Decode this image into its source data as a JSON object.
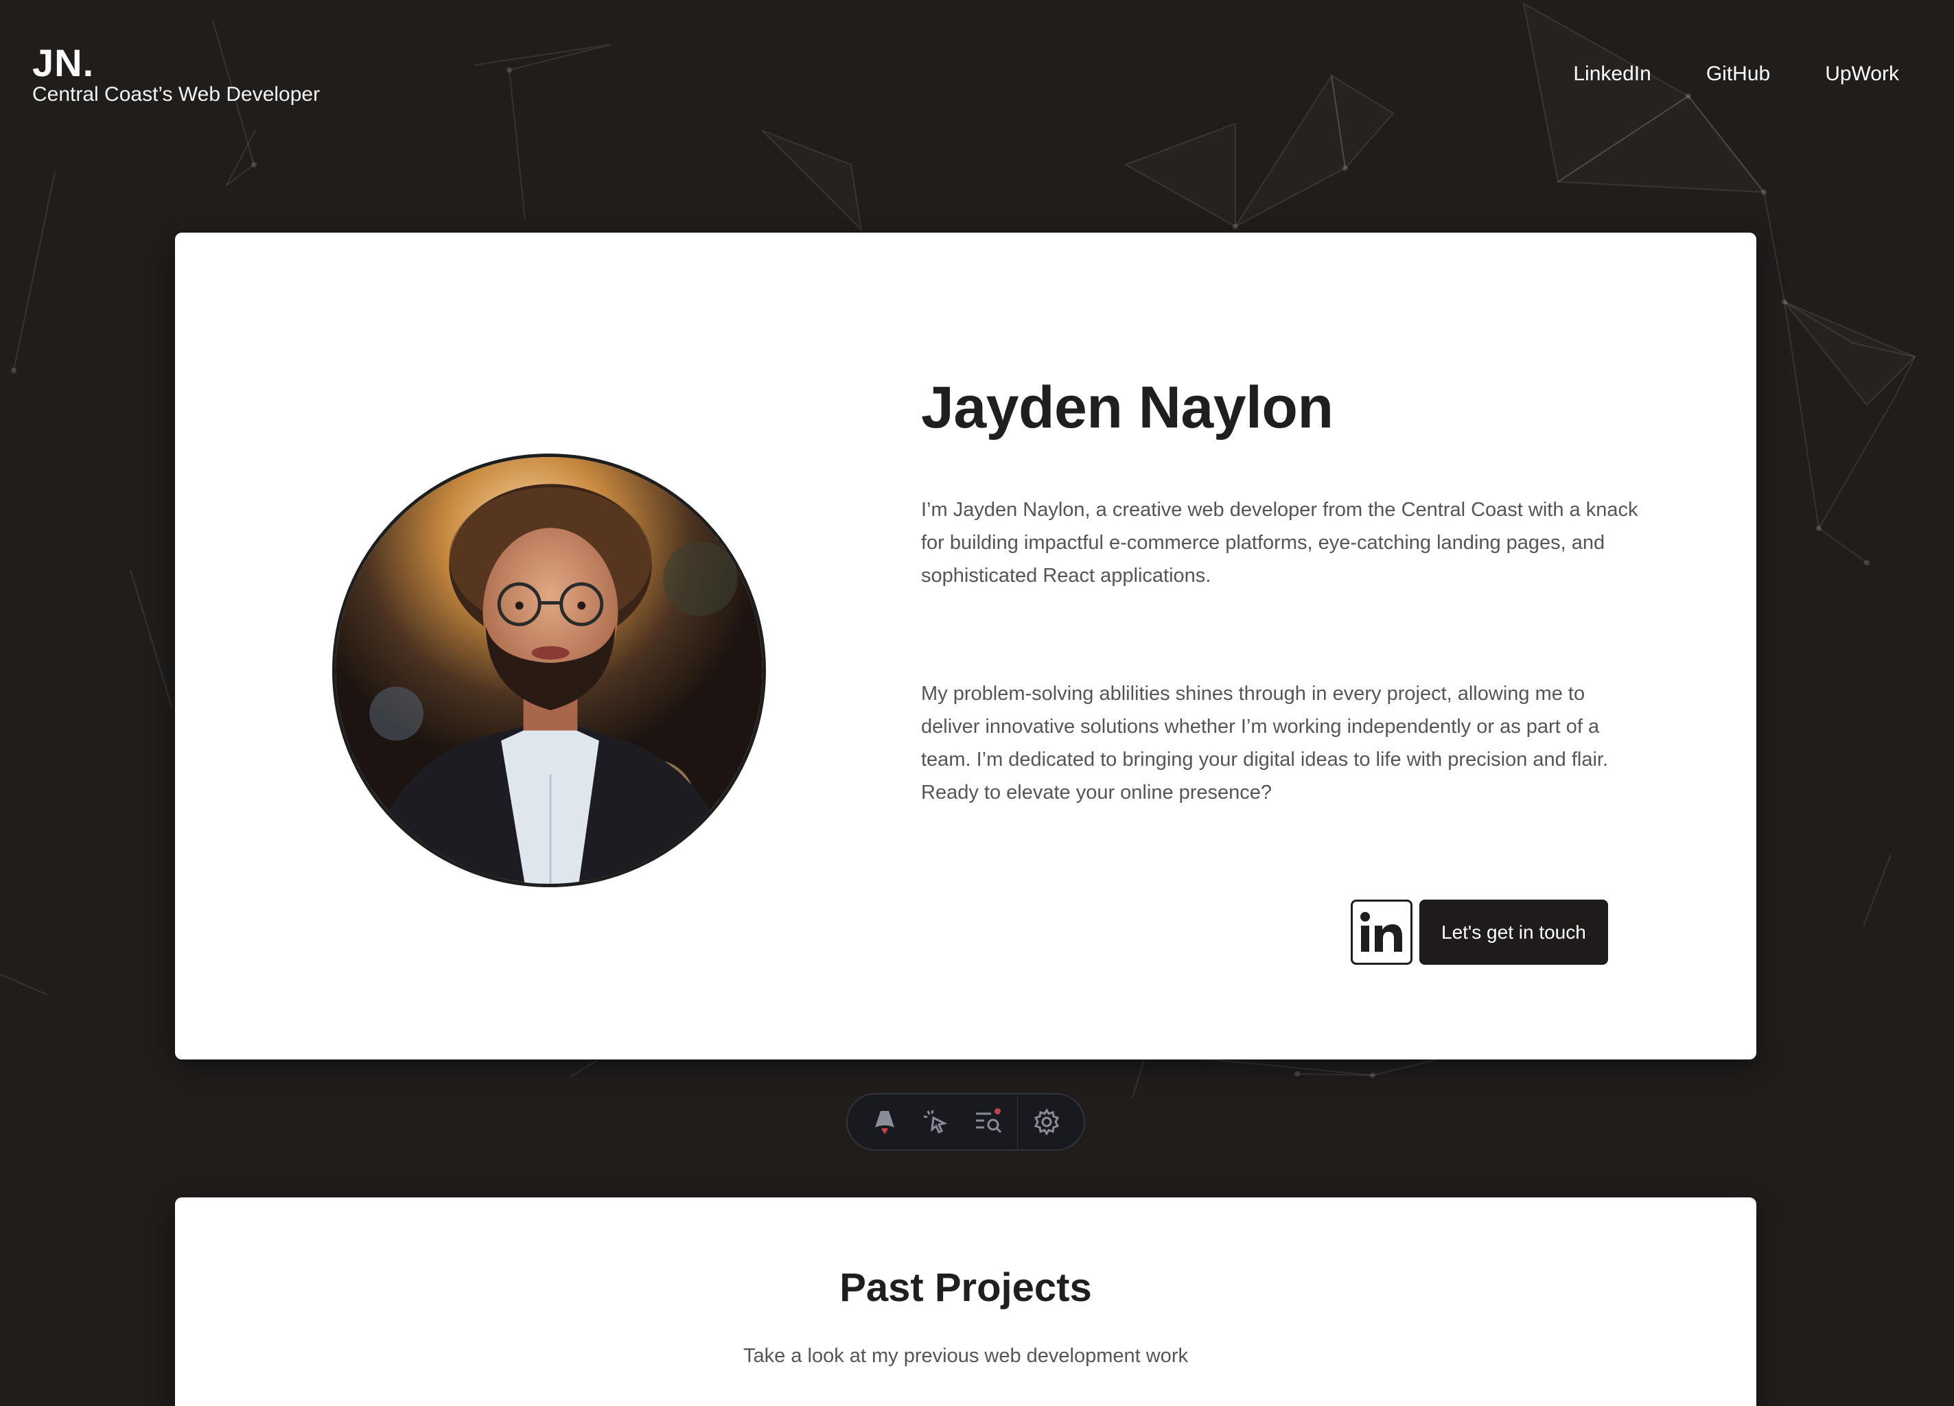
{
  "header": {
    "brand_mark": "JN.",
    "brand_tagline": "Central Coast’s Web Developer",
    "nav": [
      "LinkedIn",
      "GitHub",
      "UpWork"
    ]
  },
  "hero": {
    "title": "Jayden Naylon",
    "paragraphs": [
      "I’m Jayden Naylon, a creative web developer from the Central Coast with a knack for building impactful e-commerce platforms, eye-catching landing pages, and sophisticated React applications.",
      "My problem-solving ablilities shines through in every project, allowing me to deliver innovative solutions whether I’m working independently or as part of a team. I’m dedicated to bringing your digital ideas to life with precision and flair. Ready to elevate your online presence?"
    ],
    "linkedin_icon": "linkedin-icon",
    "cta_label": "Let's get in touch"
  },
  "devbar": {
    "tools": [
      "astro-icon",
      "cursor-click-icon",
      "search-list-icon",
      "gear-icon"
    ]
  },
  "projects": {
    "title": "Past Projects",
    "subtitle": "Take a look at my previous web development work"
  },
  "colors": {
    "background": "#201d1b",
    "card": "#ffffff",
    "button": "#1e1b1a",
    "text_dark": "#1f1f1f",
    "text_body": "#555555"
  }
}
